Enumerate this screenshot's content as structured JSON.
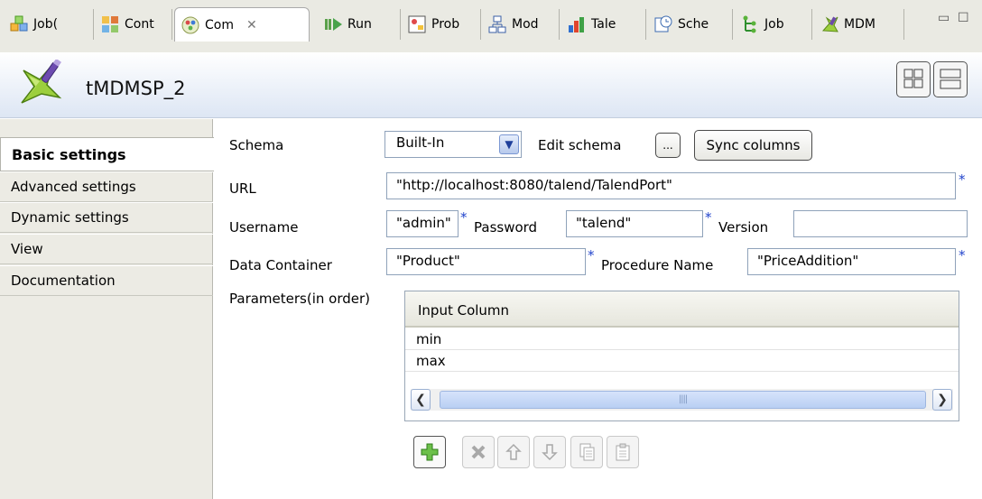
{
  "tabs": [
    {
      "label": "Job(",
      "icon": "job-icon"
    },
    {
      "label": "Cont",
      "icon": "contexts-icon"
    },
    {
      "label": "Com",
      "icon": "component-icon",
      "active": true
    },
    {
      "label": "Run",
      "icon": "run-icon"
    },
    {
      "label": "Prob",
      "icon": "problems-icon"
    },
    {
      "label": "Mod",
      "icon": "modules-icon"
    },
    {
      "label": "Tale",
      "icon": "talend-icon"
    },
    {
      "label": "Sche",
      "icon": "scheduler-icon"
    },
    {
      "label": "Job",
      "icon": "job-hierarchy-icon"
    },
    {
      "label": "MDM",
      "icon": "mdm-icon"
    }
  ],
  "header": {
    "title": "tMDMSP_2"
  },
  "nav": [
    {
      "label": "Basic settings",
      "active": true
    },
    {
      "label": "Advanced settings"
    },
    {
      "label": "Dynamic settings"
    },
    {
      "label": "View"
    },
    {
      "label": "Documentation"
    }
  ],
  "form": {
    "schema_label": "Schema",
    "schema_value": "Built-In",
    "edit_schema_label": "Edit schema",
    "edit_schema_btn": "...",
    "sync_columns": "Sync columns",
    "url_label": "URL",
    "url_value": "\"http://localhost:8080/talend/TalendPort\"",
    "username_label": "Username",
    "username_value": "\"admin\"",
    "password_label": "Password",
    "password_value": "\"talend\"",
    "version_label": "Version",
    "version_value": "",
    "container_label": "Data Container",
    "container_value": "\"Product\"",
    "procedure_label": "Procedure Name",
    "procedure_value": "\"PriceAddition\"",
    "params_label": "Parameters(in order)",
    "required_marker": "*"
  },
  "table": {
    "header": "Input Column",
    "rows": [
      "min",
      "max"
    ]
  },
  "toolbar": [
    "add-icon",
    "delete-icon",
    "move-up-icon",
    "move-down-icon",
    "copy-icon",
    "paste-icon"
  ],
  "colors": {
    "accent": "#8fa2ba",
    "header_bg": "#dde6f4",
    "nav_bg": "#ecebe4"
  }
}
